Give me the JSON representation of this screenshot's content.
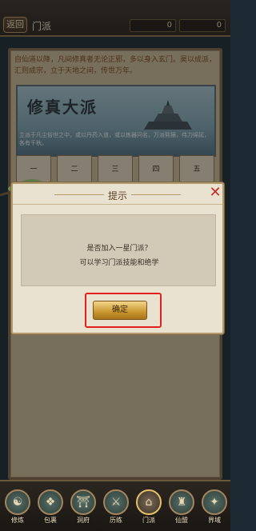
{
  "topbar": {
    "back_label": "返回",
    "title": "门派",
    "resources": [
      {
        "icon": "gourd-icon",
        "value": "0"
      },
      {
        "icon": "leaf-icon",
        "value": "0"
      }
    ]
  },
  "intro": {
    "text": "自仙道以降，凡间修真者无论正邪，多以身入玄门。昊以成派，汇则成宗，立于天地之间，传世万年。"
  },
  "banner": {
    "title": "修真大派",
    "desc": "立派于凡尘俗世之中，或以丹药入道，或以炼器问名，万派熙攘，伟力绵延，各有千秋。"
  },
  "rank_tabs": [
    "一",
    "二",
    "三",
    "四",
    "五"
  ],
  "dialog": {
    "title": "提示",
    "message_line1": "是否加入一星门派？",
    "message_line2": "可以学习门派技能和绝学",
    "confirm_label": "确定"
  },
  "bottom_nav": [
    {
      "label": "修炼",
      "icon": "meditation-icon"
    },
    {
      "label": "包裹",
      "icon": "bag-icon"
    },
    {
      "label": "洞府",
      "icon": "cave-icon"
    },
    {
      "label": "历练",
      "icon": "sword-icon"
    },
    {
      "label": "门派",
      "icon": "sect-icon"
    },
    {
      "label": "仙盟",
      "icon": "alliance-icon"
    },
    {
      "label": "界域",
      "icon": "realm-icon"
    }
  ],
  "colors": {
    "accent_red": "#e4201e",
    "gold_button": "#c9962f",
    "panel": "#c9b896"
  }
}
